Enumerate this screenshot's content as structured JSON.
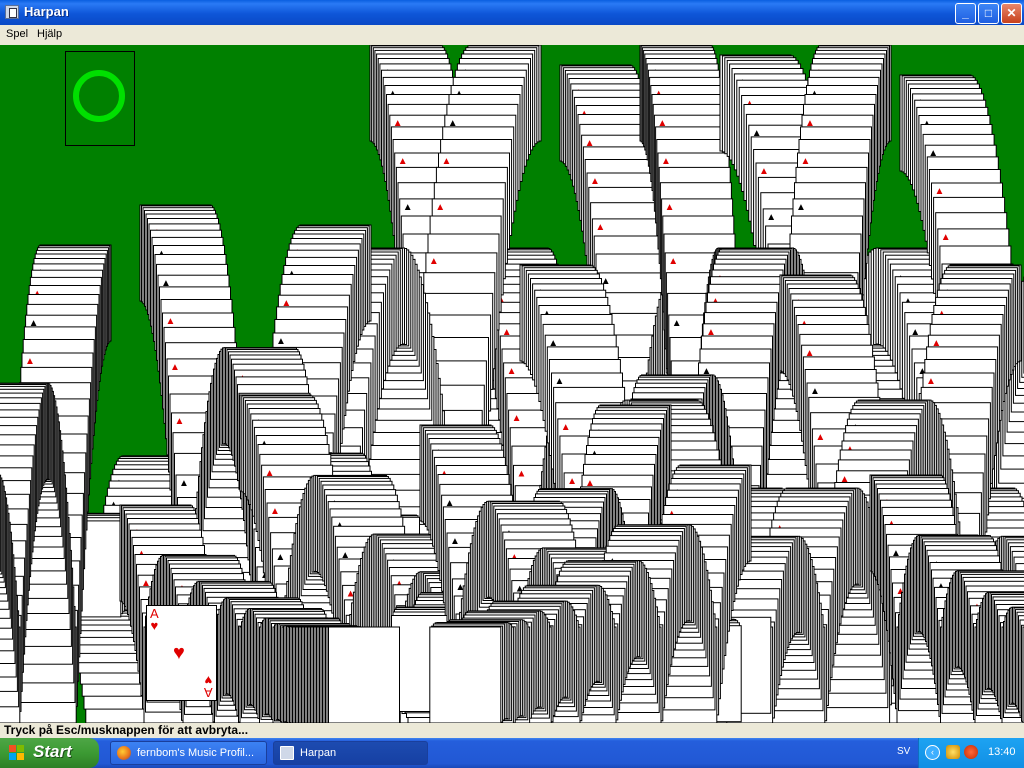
{
  "window": {
    "title": "Harpan"
  },
  "title_buttons": {
    "minimize": "_",
    "maximize": "□",
    "close": "✕"
  },
  "menu": [
    {
      "label": "Spel"
    },
    {
      "label": "Hjälp"
    }
  ],
  "card": {
    "rank": "A",
    "suit": "♥"
  },
  "status": {
    "text": "Tryck på Esc/musknappen för att avbryta..."
  },
  "taskbar": {
    "start_label": "Start",
    "tasks": [
      {
        "label": "fernbom's Music Profil...",
        "icon": "firefox-icon"
      },
      {
        "label": "Harpan",
        "icon": "harpan-icon"
      }
    ],
    "language": "SV",
    "tray_expand": "‹",
    "clock": "13:40"
  },
  "colors": {
    "felt": "#008000",
    "stock_ring": "#00e000",
    "red_suit": "#e00000"
  }
}
